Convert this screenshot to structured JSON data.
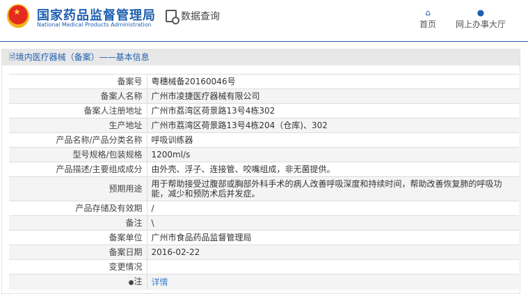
{
  "header": {
    "title_cn": "国家药品监督管理局",
    "title_en": "National Medical Products Administration",
    "query": "数据查询",
    "nav": [
      {
        "label": "首页",
        "icon": "home-icon"
      },
      {
        "label": "网上办事大厅",
        "icon": "user-icon"
      }
    ]
  },
  "panel": {
    "title": "境内医疗器械（备案）——基本信息"
  },
  "rows": [
    {
      "label": "备案号",
      "value": "粤穗械备20160046号"
    },
    {
      "label": "备案人名称",
      "value": "广州市凌捷医疗器械有限公司"
    },
    {
      "label": "备案人注册地址",
      "value": "广州市荔湾区荷景路13号4栋302"
    },
    {
      "label": "生产地址",
      "value": "广州市荔湾区荷景路13号4栋204（仓库)、302"
    },
    {
      "label": "产品名称/产品分类名称",
      "value": "呼吸训练器"
    },
    {
      "label": "型号规格/包装规格",
      "value": "1200ml/s"
    },
    {
      "label": "产品描述/主要组成成分",
      "value": "由外壳、浮子、连接管、咬嘴组成，非无菌提供。"
    },
    {
      "label": "预期用途",
      "value": "用于帮助接受过腹部或胸部外科手术的病人改善呼吸深度和持续时间，帮助改善恢复肺的呼吸功能，减少和预防术后并发症。"
    },
    {
      "label": "产品存储及有效期",
      "value": "/"
    },
    {
      "label": "备注",
      "value": "\\"
    },
    {
      "label": "备案单位",
      "value": "广州市食品药品监督管理局"
    },
    {
      "label": "备案日期",
      "value": "2016-02-22"
    },
    {
      "label": "变更情况",
      "value": ""
    },
    {
      "label": "注",
      "value": "详情"
    }
  ]
}
